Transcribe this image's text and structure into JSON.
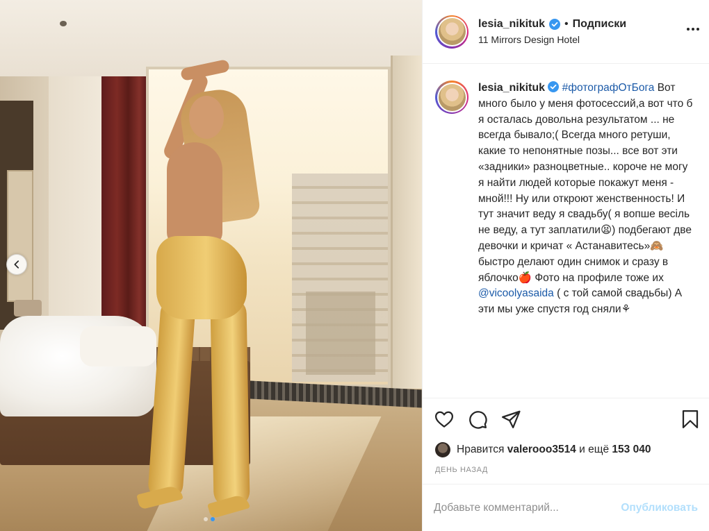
{
  "post": {
    "author": {
      "username": "lesia_nikituk",
      "verified": true,
      "follow_status": "Подписки",
      "location": "11 Mirrors Design Hotel"
    },
    "caption": {
      "username": "lesia_nikituk",
      "hashtag": "#фотографОтБога",
      "text_part1": "Вот много было у меня фотосессий,а вот что б я осталась довольна результатом ... не всегда бывало;( Всегда много ретуши, какие то непонятные позы... все вот эти «задники» разноцветные.. короче не могу я найти людей которые покажут меня - мной!!! Ну или откроют женственность! И тут значит веду я свадьбу( я вопше весіль не веду, а тут заплатили😫) подбегают две девочки и кричат « Астанавитесь»🙈 быстро делают один снимок и сразу в яблочко🍎 Фото на профиле тоже их",
      "mention": "@vicoolyasaida",
      "text_part2": "( с той самой свадьбы) А эти мы уже спустя год сняли⚘"
    },
    "likes": {
      "prefix": "Нравится",
      "user": "valerooo3514",
      "middle": "и ещё",
      "count": "153 040"
    },
    "time": "ДЕНЬ НАЗАД",
    "comment": {
      "placeholder": "Добавьте комментарий...",
      "publish": "Опубликовать"
    },
    "carousel": {
      "total": 2,
      "active_index": 1
    },
    "icons": {
      "more": "more-options-icon",
      "prev": "chevron-left-icon",
      "like": "heart-icon",
      "comment": "comment-icon",
      "share": "send-icon",
      "save": "bookmark-icon",
      "verified": "verified-badge-icon"
    },
    "colors": {
      "verified": "#3897f0",
      "link": "#1b5aa8",
      "publish": "#b2dffc",
      "muted": "#8e8e8e"
    }
  }
}
